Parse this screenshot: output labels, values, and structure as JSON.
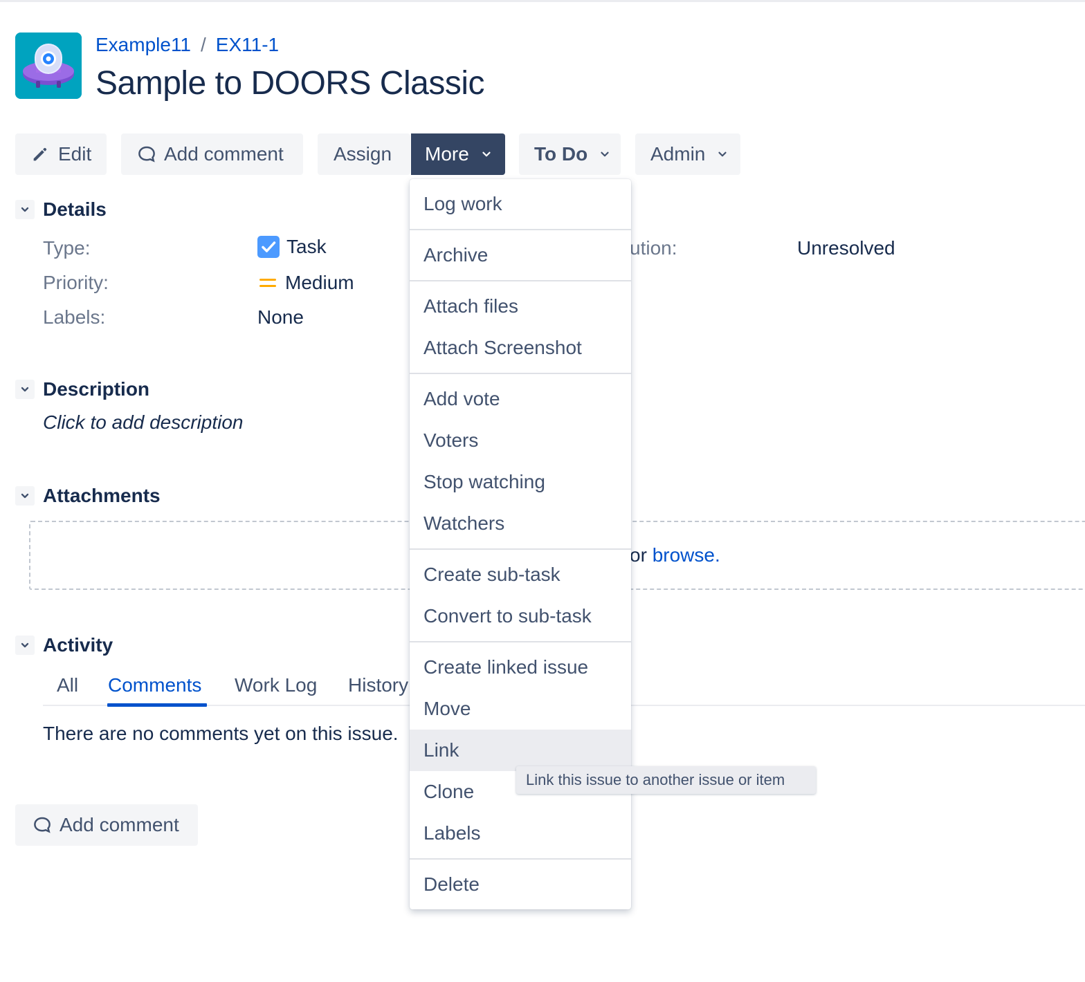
{
  "breadcrumb": {
    "project": "Example11",
    "separator": "/",
    "issue_key": "EX11-1"
  },
  "issue": {
    "title": "Sample to DOORS Classic"
  },
  "toolbar": {
    "edit": "Edit",
    "add_comment": "Add comment",
    "assign": "Assign",
    "more": "More",
    "status": "To Do",
    "admin": "Admin"
  },
  "sections": {
    "details": "Details",
    "description": "Description",
    "attachments": "Attachments",
    "activity": "Activity"
  },
  "details": {
    "type_label": "Type:",
    "type_value": "Task",
    "priority_label": "Priority:",
    "priority_value": "Medium",
    "labels_label": "Labels:",
    "labels_value": "None",
    "resolution_label_visible": "ution:",
    "resolution_value": "Unresolved"
  },
  "description": {
    "placeholder": "Click to add description"
  },
  "attachments": {
    "drop_text_visible": "or",
    "browse_link": "browse."
  },
  "activity": {
    "tabs": [
      "All",
      "Comments",
      "Work Log",
      "History"
    ],
    "active_tab": "Comments",
    "empty_message": "There are no comments yet on this issue.",
    "add_comment": "Add comment"
  },
  "more_menu": {
    "items": [
      "Log work",
      "Archive",
      "Attach files",
      "Attach Screenshot",
      "Add vote",
      "Voters",
      "Stop watching",
      "Watchers",
      "Create sub-task",
      "Convert to sub-task",
      "Create linked issue",
      "Move",
      "Link",
      "Clone",
      "Labels",
      "Delete"
    ],
    "hovered_item": "Link"
  },
  "tooltip": {
    "text": "Link this issue to another issue or item"
  },
  "colors": {
    "link_blue": "#0052cc",
    "dark_button": "#344563",
    "text_primary": "#172b4d",
    "text_subtle": "#6b778c",
    "task_icon": "#4c9aff",
    "priority_medium": "#ffab00",
    "avatar_bg": "#00a3bf",
    "avatar_mascot": "#8c5cd6"
  },
  "icons": {
    "project_avatar": "rocket-mascot-icon",
    "edit": "pencil-icon",
    "comment": "speech-bubble-icon",
    "chevron": "chevron-down-icon",
    "task_type": "checkbox-icon",
    "priority": "priority-medium-icon"
  }
}
